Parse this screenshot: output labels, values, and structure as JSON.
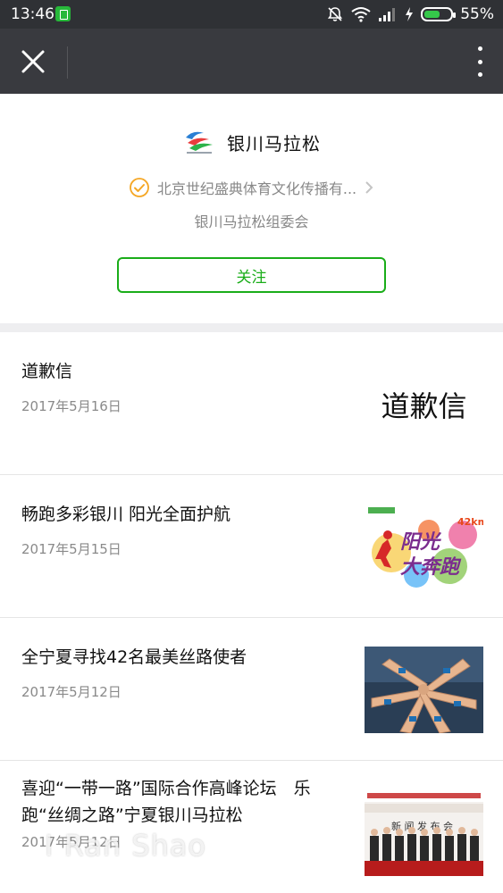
{
  "status_bar": {
    "time": "13:46",
    "battery_percent": "55%",
    "icons": [
      "app-notification-icon",
      "mute-icon",
      "wifi-icon",
      "signal-icon",
      "charging-icon",
      "battery-icon"
    ]
  },
  "navbar": {
    "close_icon": "close-icon",
    "more_icon": "more-vertical-icon"
  },
  "account": {
    "name": "银川马拉松",
    "logo_icon": "account-logo",
    "verified_by": "北京世纪盛典体育文化传播有...",
    "organizer": "银川马拉松组委会",
    "follow_label": "关注",
    "accent_color": "#1aad19"
  },
  "articles": [
    {
      "title": "道歉信",
      "date": "2017年5月16日",
      "thumb_text": "道歉信"
    },
    {
      "title": "畅跑多彩银川 阳光全面护航",
      "date": "2017年5月15日",
      "thumb_label": "阳光大奔跑",
      "thumb_badge": "42公里"
    },
    {
      "title": "全宁夏寻找42名最美丝路使者",
      "date": "2017年5月12日"
    },
    {
      "title": "喜迎“一带一路”国际合作高峰论坛　乐跑“丝绸之路”宁夏银川马拉松",
      "date": "2017年5月12日",
      "thumb_banner": "新 闻 发 布 会"
    }
  ],
  "watermark": "I Ran Shao"
}
